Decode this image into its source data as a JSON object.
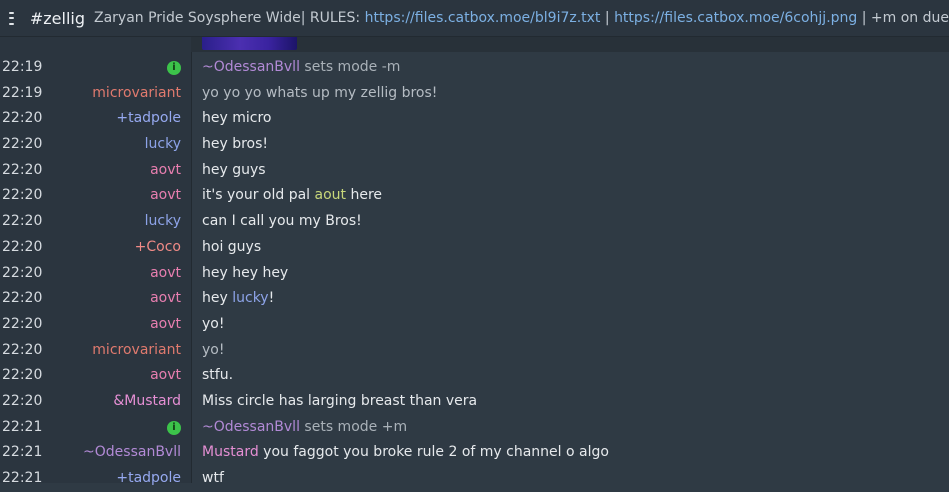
{
  "header": {
    "channel": "#zellig",
    "topic_prefix": "Zaryan Pride Soysphere Wide| RULES: ",
    "topic_link1": "https://files.catbox.moe/bl9i7z.txt",
    "topic_sep": " | ",
    "topic_link2": "https://files.catbox.moe/6cohjj.png",
    "topic_suffix": " | +m on due"
  },
  "colors": {
    "op_nick": "#b28ad6",
    "microvariant": "#e07a6e",
    "tadpole": "#96a9f0",
    "lucky": "#8da3e8",
    "aovt": "#e87fb0",
    "coco": "#ef8a86",
    "mustard": "#e58fd4",
    "aout": "#c7d77a"
  },
  "messages": [
    {
      "time": "22:19",
      "nick": "",
      "icon": "info-icon",
      "text": "~OdessanBvll sets mode -m"
    },
    {
      "time": "22:19",
      "nick": "microvariant",
      "text": "yo yo yo whats up my zellig bros!"
    },
    {
      "time": "22:20",
      "nick": "+tadpole",
      "text": "hey micro"
    },
    {
      "time": "22:20",
      "nick": "lucky",
      "text": "hey bros!"
    },
    {
      "time": "22:20",
      "nick": "aovt",
      "text": "hey guys"
    },
    {
      "time": "22:20",
      "nick": "aovt",
      "text_pre": "it's your old pal ",
      "text_hl": "aout",
      "text_post": " here"
    },
    {
      "time": "22:20",
      "nick": "lucky",
      "text": "can I call you my Bros!"
    },
    {
      "time": "22:20",
      "nick": "+Coco",
      "text": "hoi guys"
    },
    {
      "time": "22:20",
      "nick": "aovt",
      "text": "hey hey hey"
    },
    {
      "time": "22:20",
      "nick": "aovt",
      "text_pre": "hey ",
      "text_hl": "lucky",
      "text_post": "!"
    },
    {
      "time": "22:20",
      "nick": "aovt",
      "text": "yo!"
    },
    {
      "time": "22:20",
      "nick": "microvariant",
      "text": "yo!"
    },
    {
      "time": "22:20",
      "nick": "aovt",
      "text": "stfu."
    },
    {
      "time": "22:20",
      "nick": "&Mustard",
      "text": "Miss circle has larging breast than vera"
    },
    {
      "time": "22:21",
      "nick": "",
      "icon": "info-icon",
      "text": "~OdessanBvll sets mode +m"
    },
    {
      "time": "22:21",
      "nick": "~OdessanBvll",
      "text_hl": "Mustard",
      "text_post": " you faggot you broke rule  2 of my channel o algo"
    },
    {
      "time": "22:21",
      "nick": "+tadpole",
      "text": "wtf"
    }
  ]
}
